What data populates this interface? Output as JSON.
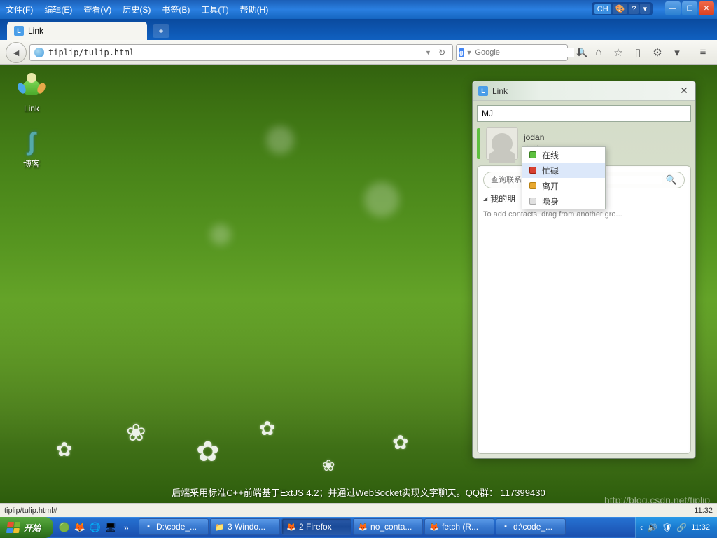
{
  "menu": {
    "file": "文件(F)",
    "edit": "编辑(E)",
    "view": "查看(V)",
    "history": "历史(S)",
    "bookmarks": "书签(B)",
    "tools": "工具(T)",
    "help": "帮助(H)"
  },
  "ime": {
    "lang": "CH"
  },
  "tab": {
    "title": "Link"
  },
  "url": {
    "value": "tiplip/tulip.html"
  },
  "search": {
    "placeholder": "Google"
  },
  "desktop": {
    "link_label": "Link",
    "blog_label": "博客"
  },
  "ext": {
    "title": "Link",
    "input_value": "MJ",
    "profile": {
      "name": "jodan",
      "status": "在线"
    },
    "search_placeholder": "查询联系",
    "group": "我的朋",
    "hint": "To add contacts, drag from another gro..."
  },
  "status_menu": {
    "online": "在线",
    "busy": "忙碌",
    "away": "离开",
    "invisible": "隐身"
  },
  "footer": "后端采用标准C++前端基于ExtJS 4.2；并通过WebSocket实现文字聊天。QQ群： 117399430",
  "watermark": "http://blog.csdn.net/tiplip",
  "status": {
    "left": "tiplip/tulip.html#",
    "right": "11:32"
  },
  "taskbar": {
    "start": "开始",
    "tasks": [
      {
        "icon": "cmd",
        "label": "D:\\code_..."
      },
      {
        "icon": "folder",
        "label": "3 Windo..."
      },
      {
        "icon": "ff",
        "label": "2 Firefox"
      },
      {
        "icon": "ff",
        "label": "no_conta..."
      },
      {
        "icon": "ff",
        "label": "fetch (R..."
      },
      {
        "icon": "cmd",
        "label": "d:\\code_..."
      }
    ],
    "clock": "11:32"
  }
}
